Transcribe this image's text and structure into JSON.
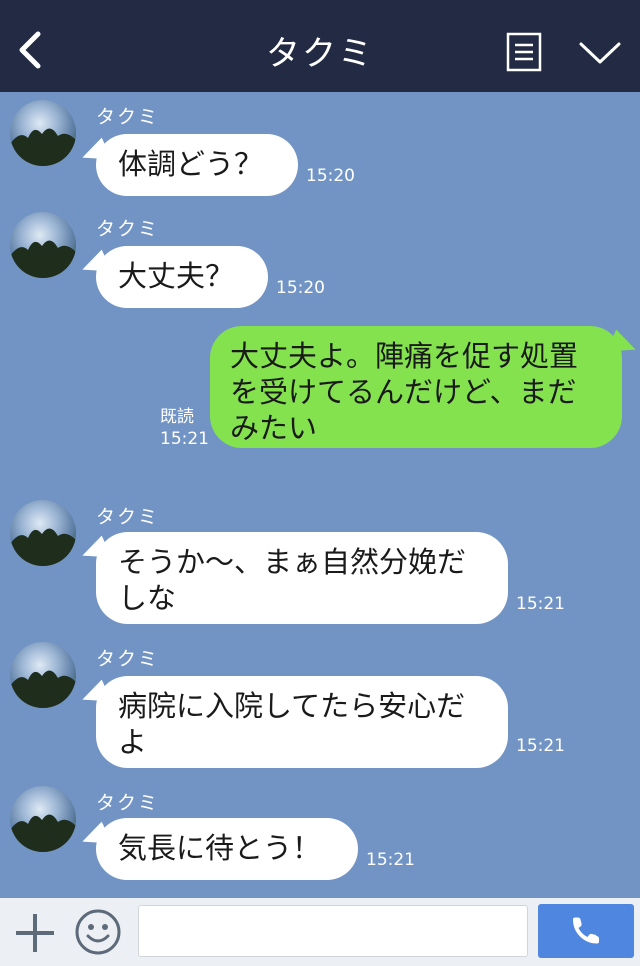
{
  "header": {
    "title": "タクミ"
  },
  "messages": [
    {
      "sender": "タクミ",
      "text": "体調どう？",
      "time": "15:20"
    },
    {
      "sender": "タクミ",
      "text": "大丈夫？",
      "time": "15:20"
    },
    {
      "sender": "me",
      "lines": [
        "大丈夫よ。陣痛を促す処置",
        "を受けてるんだけど、まだ",
        "みたい"
      ],
      "read": "既読",
      "time": "15:21"
    },
    {
      "sender": "タクミ",
      "lines": [
        "そうか〜、まぁ自然分娩だ",
        "しな"
      ],
      "time": "15:21"
    },
    {
      "sender": "タクミ",
      "lines": [
        "病院に入院してたら安心だ",
        "よ"
      ],
      "time": "15:21"
    },
    {
      "sender": "タクミ",
      "text": "気長に待とう！",
      "time": "15:21"
    }
  ],
  "colors": {
    "header_bg": "#222b43",
    "chat_bg": "#7294c5",
    "incoming_bubble": "#ffffff",
    "outgoing_bubble": "#84e24f",
    "call_button": "#4f86df"
  },
  "icons": {
    "back": "back-arrow-icon",
    "menu": "menu-list-icon",
    "collapse": "chevron-down-icon",
    "add": "plus-icon",
    "emoji": "smiley-icon",
    "call": "phone-icon"
  }
}
